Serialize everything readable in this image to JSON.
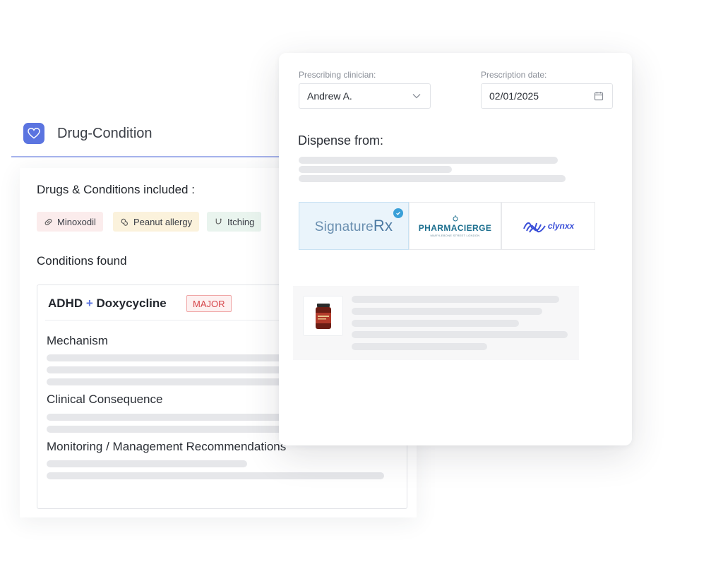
{
  "drug_condition": {
    "title": "Drug-Condition",
    "included_heading": "Drugs & Conditions included :",
    "chips": [
      {
        "label": "Minoxodil",
        "icon": "pill-icon",
        "bg": "#fbecec"
      },
      {
        "label": "Peanut allergy",
        "icon": "peanut-icon",
        "bg": "#fbf2dc"
      },
      {
        "label": "Itching",
        "icon": "condition-icon",
        "bg": "#e9f4ee"
      }
    ],
    "found_heading": "Conditions found",
    "condition": {
      "drug_a": "ADHD",
      "plus": "+",
      "drug_b": "Doxycycline",
      "severity": "MAJOR"
    },
    "sections": {
      "mechanism": "Mechanism",
      "consequence": "Clinical Consequence",
      "monitoring": "Monitoring / Management Recommendations"
    }
  },
  "prescription": {
    "clinician_label": "Prescribing clinician:",
    "clinician_value": "Andrew A.",
    "date_label": "Prescription date:",
    "date_value": "02/01/2025",
    "dispense_heading": "Dispense from:",
    "pharmacies": [
      {
        "name": "SignatureRx",
        "part1": "Signature",
        "part2": "Rx",
        "selected": true
      },
      {
        "name": "PHARMACIERGE",
        "tagline": "MARYLEBONE STREET LONDON",
        "selected": false
      },
      {
        "name": "clynxx",
        "selected": false
      }
    ]
  },
  "colors": {
    "accent": "#5b74e0",
    "severity_major": "#d6454a",
    "selected_check": "#3aa0d8",
    "pharmacierge": "#1c6f8f",
    "clynxx": "#3a4fd8"
  }
}
